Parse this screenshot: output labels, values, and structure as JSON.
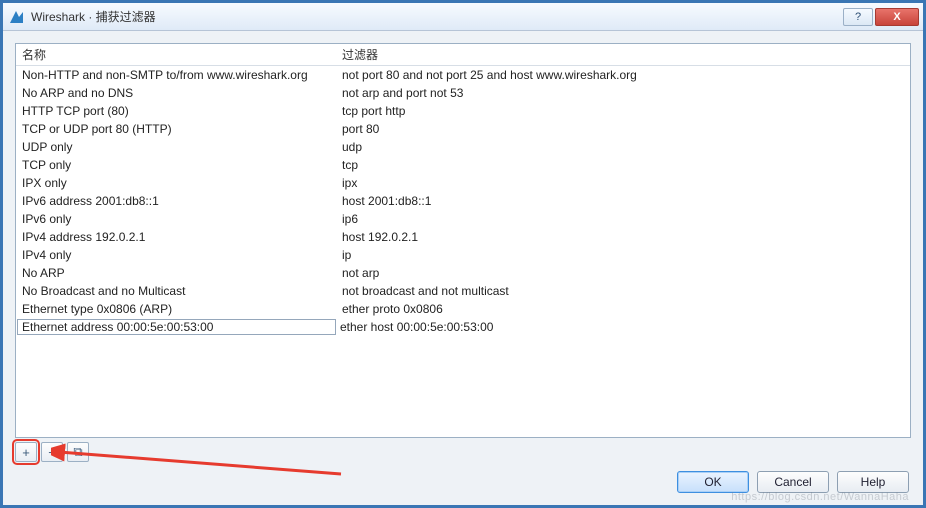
{
  "window": {
    "title": "Wireshark · 捕获过滤器",
    "icon_name": "wireshark-fin-icon"
  },
  "titlebar_buttons": {
    "help": "?",
    "close": "X"
  },
  "columns": {
    "name": "名称",
    "filter": "过滤器"
  },
  "filters": [
    {
      "name": "Non-HTTP and non-SMTP to/from www.wireshark.org",
      "filter": "not port 80 and not port 25 and host www.wireshark.org"
    },
    {
      "name": "No ARP and no DNS",
      "filter": "not arp and port not 53"
    },
    {
      "name": "HTTP TCP port (80)",
      "filter": "tcp port http"
    },
    {
      "name": "TCP or UDP port 80 (HTTP)",
      "filter": "port 80"
    },
    {
      "name": "UDP only",
      "filter": "udp"
    },
    {
      "name": "TCP only",
      "filter": "tcp"
    },
    {
      "name": "IPX only",
      "filter": "ipx"
    },
    {
      "name": "IPv6 address 2001:db8::1",
      "filter": "host 2001:db8::1"
    },
    {
      "name": "IPv6 only",
      "filter": "ip6"
    },
    {
      "name": "IPv4 address 192.0.2.1",
      "filter": "host 192.0.2.1"
    },
    {
      "name": "IPv4 only",
      "filter": "ip"
    },
    {
      "name": "No ARP",
      "filter": "not arp"
    },
    {
      "name": "No Broadcast and no Multicast",
      "filter": "not broadcast and not multicast"
    },
    {
      "name": "Ethernet type 0x0806 (ARP)",
      "filter": "ether proto 0x0806"
    },
    {
      "name": "Ethernet address 00:00:5e:00:53:00",
      "filter": "ether host 00:00:5e:00:53:00",
      "editing": true
    }
  ],
  "toolbar": {
    "add": "+",
    "remove": "−",
    "copy": "⧉"
  },
  "buttons": {
    "ok": "OK",
    "cancel": "Cancel",
    "help": "Help"
  },
  "annotation": {
    "highlight_target": "add-button",
    "arrow_color": "#e63b2e"
  },
  "watermark": "https://blog.csdn.net/WannaHaha"
}
